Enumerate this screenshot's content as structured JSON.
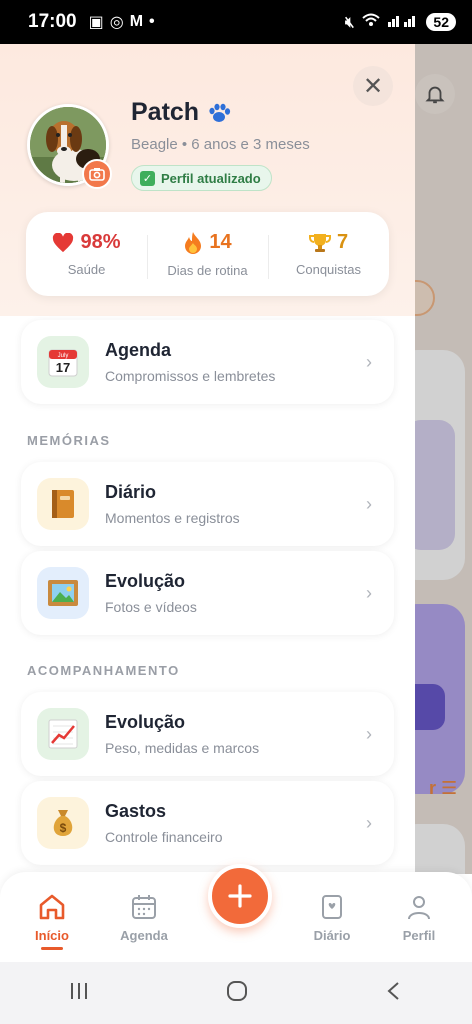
{
  "status_bar": {
    "time": "17:00",
    "battery": "52"
  },
  "profile": {
    "name": "Patch",
    "subtitle": "Beagle • 6 anos e 3 meses",
    "status_badge": "Perfil atualizado"
  },
  "stats": [
    {
      "value": "98%",
      "label": "Saúde",
      "icon": "heart-icon",
      "color": "#d93a3a"
    },
    {
      "value": "14",
      "label": "Dias de rotina",
      "icon": "fire-icon",
      "color": "#e8731f"
    },
    {
      "value": "7",
      "label": "Conquistas",
      "icon": "trophy-icon",
      "color": "#d99212"
    }
  ],
  "sections": {
    "memorias": "MEMÓRIAS",
    "acompanhamento": "ACOMPANHAMENTO"
  },
  "menu": {
    "agenda": {
      "title": "Agenda",
      "subtitle": "Compromissos e lembretes",
      "icon_text": "July",
      "icon_num": "17"
    },
    "diario": {
      "title": "Diário",
      "subtitle": "Momentos e registros"
    },
    "evolucao_fotos": {
      "title": "Evolução",
      "subtitle": "Fotos e vídeos"
    },
    "evolucao_peso": {
      "title": "Evolução",
      "subtitle": "Peso, medidas e marcos"
    },
    "gastos": {
      "title": "Gastos",
      "subtitle": "Controle financeiro"
    }
  },
  "bottom_nav": {
    "inicio": "Início",
    "agenda": "Agenda",
    "diario": "Diário",
    "perfil": "Perfil"
  },
  "colors": {
    "accent": "#f26a3a",
    "active": "#e85a2b"
  }
}
